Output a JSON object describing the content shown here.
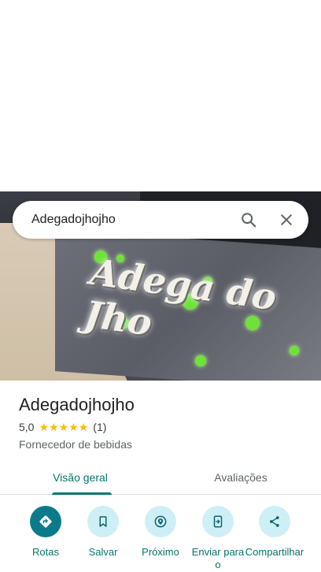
{
  "search": {
    "value": "Adegadojhojho",
    "search_icon": "search-icon",
    "clear_icon": "close-icon"
  },
  "hero": {
    "graffiti_text": "Adega do Jho",
    "accent": "#6fe23a"
  },
  "place": {
    "name": "Adegadojhojho",
    "rating": "5,0",
    "stars": 5,
    "review_count": "(1)",
    "category": "Fornecedor de bebidas"
  },
  "tabs": [
    {
      "label": "Visão geral",
      "active": true
    },
    {
      "label": "Avaliações",
      "active": false
    }
  ],
  "actions": [
    {
      "label": "Rotas",
      "icon": "directions-icon"
    },
    {
      "label": "Salvar",
      "icon": "bookmark-icon"
    },
    {
      "label": "Próximo",
      "icon": "nearby-icon"
    },
    {
      "label": "Enviar para o",
      "icon": "send-to-phone-icon"
    },
    {
      "label": "Compartilhar",
      "icon": "share-icon"
    }
  ],
  "colors": {
    "accent": "#00796b",
    "primary_action": "#0b7b8b",
    "action_bg": "#cfeff6",
    "star": "#fbbc04"
  }
}
